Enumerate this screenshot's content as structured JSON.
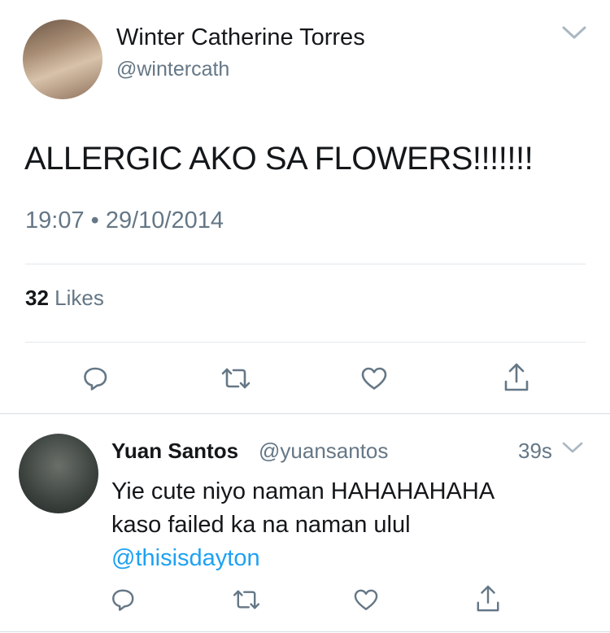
{
  "tweet": {
    "author_name": "Winter Catherine Torres",
    "author_handle": "@wintercath",
    "text": "ALLERGIC AKO SA FLOWERS!!!!!!!",
    "time": "19:07",
    "separator": "•",
    "date": "29/10/2014",
    "likes_count": "32",
    "likes_label": "Likes"
  },
  "reply": {
    "author_name": "Yuan Santos",
    "author_handle": "@yuansantos",
    "age": "39s",
    "text_line1": "Yie cute niyo naman HAHAHAHAHA",
    "text_line2": "kaso failed ka na naman ulul",
    "mention": "@thisisdayton"
  },
  "icons": {
    "chevron": "chevron-down-icon",
    "reply": "reply-icon",
    "retweet": "retweet-icon",
    "like": "heart-icon",
    "share": "share-icon"
  },
  "colors": {
    "text": "#14171a",
    "secondary": "#657786",
    "link": "#1da1f2",
    "divider": "#e1e8ed"
  }
}
